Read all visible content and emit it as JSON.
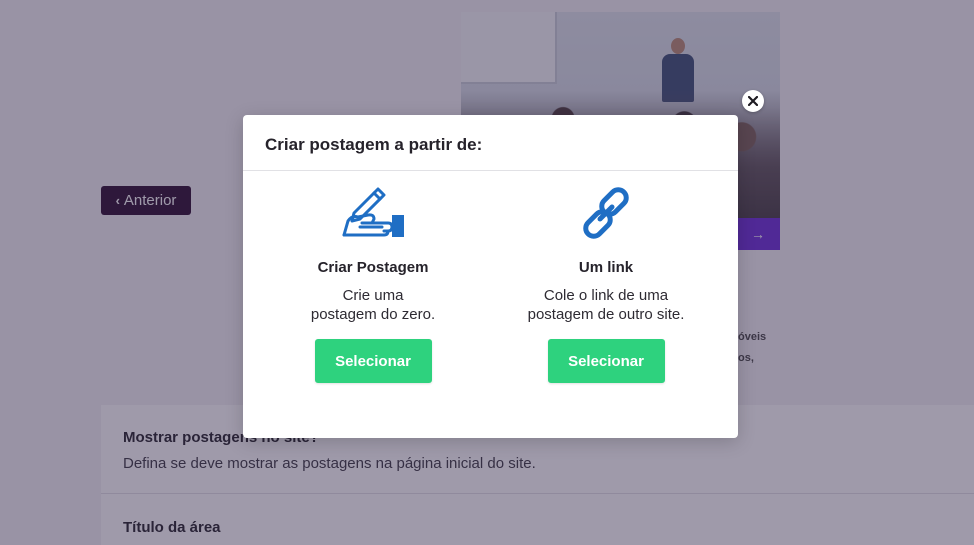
{
  "background": {
    "prev_button_label": "Anterior",
    "photo_arrow": "→",
    "side_text_1": "óveis",
    "side_text_2": "os,",
    "settings": {
      "show_posts_title": "Mostrar postagens no site?",
      "show_posts_desc": "Defina se deve mostrar as postagens na página inicial do site.",
      "area_title": "Título da área"
    }
  },
  "modal": {
    "title": "Criar postagem a partir de:",
    "options": [
      {
        "icon": "hand-writing-icon",
        "title": "Criar Postagem",
        "desc_lines": [
          "Crie uma",
          "postagem do zero."
        ],
        "button_label": "Selecionar"
      },
      {
        "icon": "link-chain-icon",
        "title": "Um link",
        "desc_lines": [
          "Cole o link de uma",
          "postagem de outro site."
        ],
        "button_label": "Selecionar"
      }
    ]
  },
  "colors": {
    "accent_green": "#2ed27e",
    "icon_blue": "#1f6ec4",
    "prev_button_bg": "#2a0a2e",
    "overlay": "rgba(52,40,74,0.47)",
    "photo_bar_purple": "#6a2bd9"
  }
}
